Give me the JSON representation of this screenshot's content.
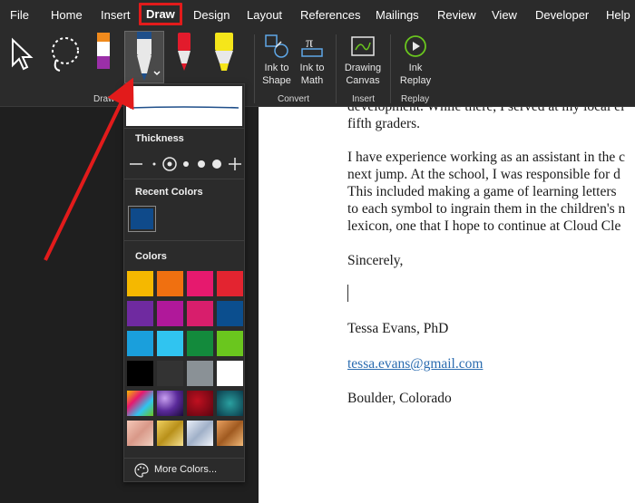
{
  "menu": {
    "items": [
      "File",
      "Home",
      "Insert",
      "Draw",
      "Design",
      "Layout",
      "References",
      "Mailings",
      "Review",
      "View",
      "Developer",
      "Help"
    ],
    "active": "Draw"
  },
  "ribbon": {
    "groups": {
      "draw": "Draw",
      "convert": "Convert",
      "insert": "Insert",
      "replay": "Replay"
    },
    "buttons": {
      "ink_to_shape_1": "Ink to",
      "ink_to_shape_2": "Shape",
      "ink_to_math_1": "Ink to",
      "ink_to_math_2": "Math",
      "drawing_canvas_1": "Drawing",
      "drawing_canvas_2": "Canvas",
      "ink_replay_1": "Ink",
      "ink_replay_2": "Replay"
    },
    "pens": [
      {
        "name": "select-tool",
        "color": "#ffffff"
      },
      {
        "name": "lasso-tool",
        "color": "#ffffff"
      },
      {
        "name": "purple-pen",
        "color": "#9b2fa8"
      },
      {
        "name": "blue-pen",
        "color": "#1f4f8a"
      },
      {
        "name": "red-pen",
        "color": "#e21b2c"
      },
      {
        "name": "yellow-highlighter",
        "color": "#f5e61a"
      }
    ]
  },
  "pen_panel": {
    "thickness_label": "Thickness",
    "recent_colors_label": "Recent Colors",
    "colors_label": "Colors",
    "more_colors_label": "More Colors...",
    "recent_color": "#0f4a8a",
    "colors": [
      "#f5b800",
      "#f07010",
      "#e6196e",
      "#e32430",
      "#6f2aa0",
      "#b0189a",
      "#d81e6c",
      "#0b4e8e",
      "#1a9fdc",
      "#30c4f0",
      "#138a3c",
      "#6ac61e",
      "#000000",
      "#333333",
      "#8a9196",
      "#ffffff"
    ],
    "textures": [
      "rainbow",
      "galaxy",
      "ruby",
      "ocean",
      "rose-gold",
      "gold",
      "silver",
      "bronze"
    ]
  },
  "document": {
    "lines": [
      "development. While there, I served at my local el",
      "fifth graders.",
      "I have experience working as an assistant in the c",
      "next jump. At the school, I was responsible for d",
      "This included making a game of learning letters",
      "to each symbol to ingrain them in the children's n",
      "lexicon, one that I hope to continue at Cloud Cle",
      "Sincerely,",
      "Tessa Evans, PhD",
      "tessa.evans@gmail.com",
      "Boulder, Colorado"
    ]
  }
}
